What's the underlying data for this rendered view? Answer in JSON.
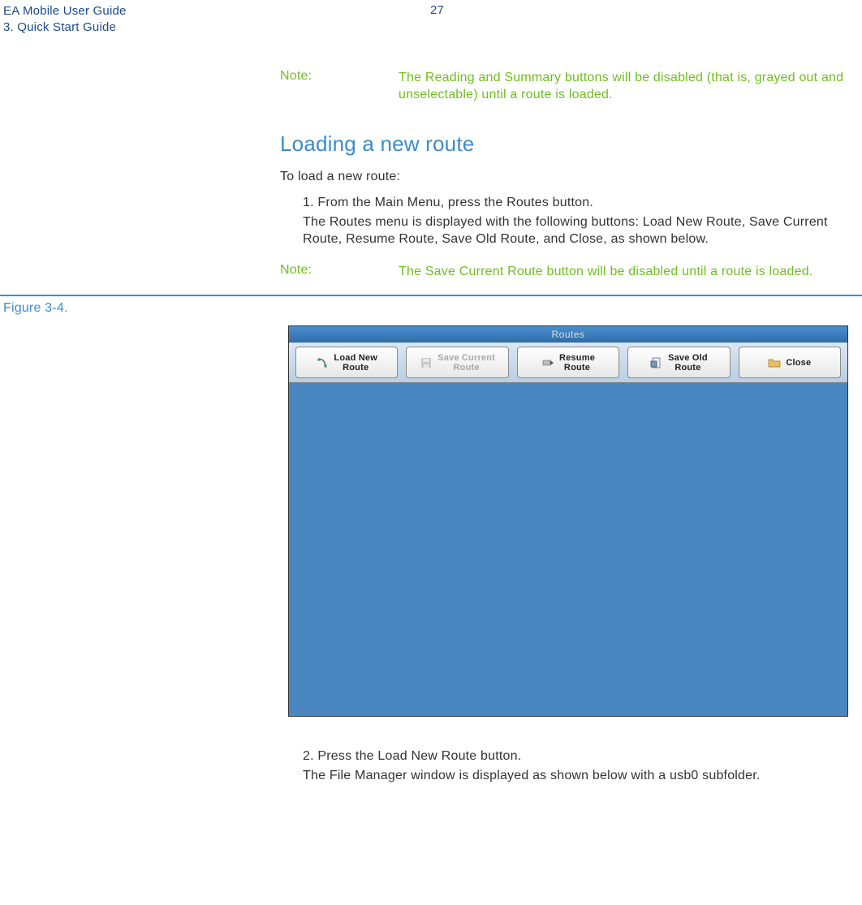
{
  "header": {
    "title_line1": "EA Mobile User Guide",
    "title_line2": "3. Quick Start Guide",
    "page_number": "27"
  },
  "note1": {
    "label": "Note:",
    "body": "The Reading and Summary buttons will be disabled (that is, grayed out and unselectable) until a route is loaded."
  },
  "section": {
    "heading": "Loading a new route",
    "intro": "To load a new route:",
    "step1_line": "1.  From the Main Menu, press the Routes button.",
    "step1_cont": "The Routes menu is displayed with the following buttons: Load New Route, Save Current Route, Resume Route, Save Old Route, and Close, as shown below."
  },
  "note2": {
    "label": "Note:",
    "body": "The Save Current Route button will be disabled until a route is loaded."
  },
  "figure": {
    "label": "Figure 3-4.",
    "window_title": "Routes",
    "buttons": {
      "load_new": "Load New\nRoute",
      "save_current": "Save Current\nRoute",
      "resume": "Resume\nRoute",
      "save_old": "Save Old\nRoute",
      "close": "Close"
    }
  },
  "section2": {
    "step2_line": "2. Press the Load New Route button.",
    "step2_cont": "The File Manager window is displayed as shown below with a usb0 subfolder."
  }
}
